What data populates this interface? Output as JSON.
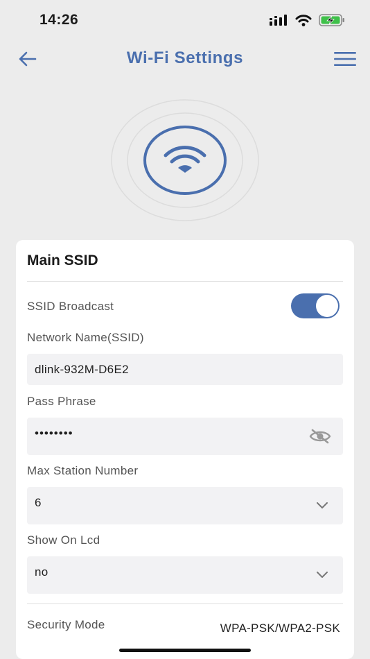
{
  "status_bar": {
    "time": "14:26"
  },
  "header": {
    "title": "Wi-Fi Settings"
  },
  "card": {
    "title": "Main SSID",
    "ssid_broadcast": {
      "label": "SSID Broadcast",
      "enabled": true
    },
    "network_name": {
      "label": "Network Name(SSID)",
      "value": "dlink-932M-D6E2"
    },
    "pass_phrase": {
      "label": "Pass Phrase",
      "value": "••••••••"
    },
    "max_station": {
      "label": "Max Station Number",
      "value": "6"
    },
    "show_on_lcd": {
      "label": "Show On Lcd",
      "value": "no"
    },
    "security_mode": {
      "label": "Security Mode",
      "value": "WPA-PSK/WPA2-PSK"
    }
  },
  "colors": {
    "accent": "#4a6fae",
    "background": "#ececec",
    "field": "#f2f2f4"
  }
}
